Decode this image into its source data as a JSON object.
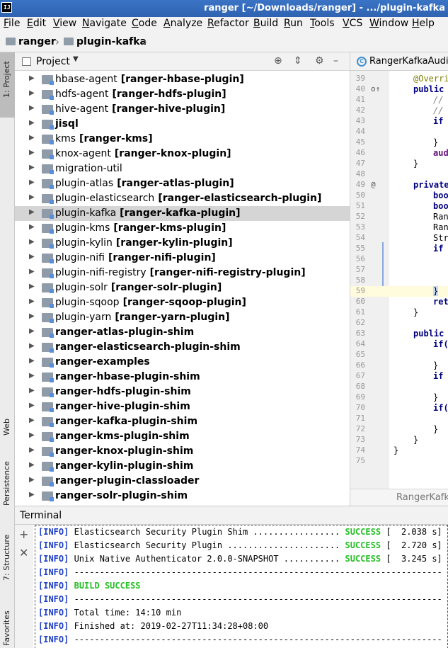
{
  "window": {
    "app_icon": "IJ",
    "title": "ranger [~/Downloads/ranger] - .../plugin-kafka"
  },
  "menu": [
    "File",
    "Edit",
    "View",
    "Navigate",
    "Code",
    "Analyze",
    "Refactor",
    "Build",
    "Run",
    "Tools",
    "VCS",
    "Window",
    "Help"
  ],
  "breadcrumb": [
    "ranger",
    "plugin-kafka"
  ],
  "left_tool_tabs": {
    "project": "1: Project",
    "web": "Web",
    "persistence": "Persistence",
    "structure": "7: Structure",
    "favorites": "Favorites"
  },
  "project_panel": {
    "title": "Project",
    "items": [
      {
        "name": "hbase-agent",
        "module": "[ranger-hbase-plugin]",
        "bold": false
      },
      {
        "name": "hdfs-agent",
        "module": "[ranger-hdfs-plugin]",
        "bold": false
      },
      {
        "name": "hive-agent",
        "module": "[ranger-hive-plugin]",
        "bold": false
      },
      {
        "name": "jisql",
        "module": "",
        "bold": true
      },
      {
        "name": "kms",
        "module": "[ranger-kms]",
        "bold": false
      },
      {
        "name": "knox-agent",
        "module": "[ranger-knox-plugin]",
        "bold": false
      },
      {
        "name": "migration-util",
        "module": "",
        "bold": false
      },
      {
        "name": "plugin-atlas",
        "module": "[ranger-atlas-plugin]",
        "bold": false
      },
      {
        "name": "plugin-elasticsearch",
        "module": "[ranger-elasticsearch-plugin]",
        "bold": false
      },
      {
        "name": "plugin-kafka",
        "module": "[ranger-kafka-plugin]",
        "bold": false,
        "selected": true
      },
      {
        "name": "plugin-kms",
        "module": "[ranger-kms-plugin]",
        "bold": false
      },
      {
        "name": "plugin-kylin",
        "module": "[ranger-kylin-plugin]",
        "bold": false
      },
      {
        "name": "plugin-nifi",
        "module": "[ranger-nifi-plugin]",
        "bold": false
      },
      {
        "name": "plugin-nifi-registry",
        "module": "[ranger-nifi-registry-plugin]",
        "bold": false
      },
      {
        "name": "plugin-solr",
        "module": "[ranger-solr-plugin]",
        "bold": false
      },
      {
        "name": "plugin-sqoop",
        "module": "[ranger-sqoop-plugin]",
        "bold": false
      },
      {
        "name": "plugin-yarn",
        "module": "[ranger-yarn-plugin]",
        "bold": false
      },
      {
        "name": "ranger-atlas-plugin-shim",
        "module": "",
        "bold": true
      },
      {
        "name": "ranger-elasticsearch-plugin-shim",
        "module": "",
        "bold": true
      },
      {
        "name": "ranger-examples",
        "module": "",
        "bold": true
      },
      {
        "name": "ranger-hbase-plugin-shim",
        "module": "",
        "bold": true
      },
      {
        "name": "ranger-hdfs-plugin-shim",
        "module": "",
        "bold": true
      },
      {
        "name": "ranger-hive-plugin-shim",
        "module": "",
        "bold": true
      },
      {
        "name": "ranger-kafka-plugin-shim",
        "module": "",
        "bold": true
      },
      {
        "name": "ranger-kms-plugin-shim",
        "module": "",
        "bold": true
      },
      {
        "name": "ranger-knox-plugin-shim",
        "module": "",
        "bold": true
      },
      {
        "name": "ranger-kylin-plugin-shim",
        "module": "",
        "bold": true
      },
      {
        "name": "ranger-plugin-classloader",
        "module": "",
        "bold": true
      },
      {
        "name": "ranger-solr-plugin-shim",
        "module": "",
        "bold": true
      }
    ]
  },
  "editor": {
    "tab": "RangerKafkaAudi",
    "footer": "RangerKafk",
    "lines": [
      {
        "n": "39",
        "code": "@Overri",
        "cls": "ann",
        "indent": 0
      },
      {
        "n": "40",
        "code": "public ",
        "cls": "kw",
        "indent": 0,
        "mark": "o↑"
      },
      {
        "n": "41",
        "code": "//",
        "cls": "cmt",
        "indent": 2
      },
      {
        "n": "42",
        "code": "//",
        "cls": "cmt",
        "indent": 2
      },
      {
        "n": "43",
        "code": "if",
        "cls": "kw",
        "indent": 2
      },
      {
        "n": "44",
        "code": "",
        "cls": "",
        "indent": 0
      },
      {
        "n": "45",
        "code": "}",
        "cls": "",
        "indent": 2
      },
      {
        "n": "46",
        "code": "aud",
        "cls": "fld",
        "indent": 2
      },
      {
        "n": "47",
        "code": "}",
        "cls": "",
        "indent": 0
      },
      {
        "n": "48",
        "code": "",
        "cls": "",
        "indent": 0
      },
      {
        "n": "49",
        "code": "private",
        "cls": "kw",
        "indent": 0,
        "mark": "@"
      },
      {
        "n": "50",
        "code": "boo",
        "cls": "kw",
        "indent": 2
      },
      {
        "n": "51",
        "code": "boo",
        "cls": "kw",
        "indent": 2
      },
      {
        "n": "52",
        "code": "Ran",
        "cls": "",
        "indent": 2
      },
      {
        "n": "53",
        "code": "Ran",
        "cls": "",
        "indent": 2
      },
      {
        "n": "54",
        "code": "Str",
        "cls": "",
        "indent": 2
      },
      {
        "n": "55",
        "code": "if",
        "cls": "kw",
        "indent": 2
      },
      {
        "n": "56",
        "code": "",
        "cls": "",
        "indent": 0
      },
      {
        "n": "57",
        "code": "",
        "cls": "",
        "indent": 0
      },
      {
        "n": "58",
        "code": "",
        "cls": "",
        "indent": 0
      },
      {
        "n": "59",
        "code": "}",
        "cls": "",
        "indent": 2,
        "caret": true
      },
      {
        "n": "60",
        "code": "ret",
        "cls": "kw",
        "indent": 2
      },
      {
        "n": "61",
        "code": "}",
        "cls": "",
        "indent": 0
      },
      {
        "n": "62",
        "code": "",
        "cls": "",
        "indent": 0
      },
      {
        "n": "63",
        "code": "public ",
        "cls": "kw",
        "indent": 0
      },
      {
        "n": "64",
        "code": "if(",
        "cls": "kw",
        "indent": 2
      },
      {
        "n": "65",
        "code": "",
        "cls": "",
        "indent": 0
      },
      {
        "n": "66",
        "code": "}",
        "cls": "",
        "indent": 2
      },
      {
        "n": "67",
        "code": "if",
        "cls": "kw",
        "indent": 2
      },
      {
        "n": "68",
        "code": "",
        "cls": "",
        "indent": 0
      },
      {
        "n": "69",
        "code": "}",
        "cls": "",
        "indent": 2
      },
      {
        "n": "70",
        "code": "if(",
        "cls": "kw",
        "indent": 2
      },
      {
        "n": "71",
        "code": "",
        "cls": "",
        "indent": 0
      },
      {
        "n": "72",
        "code": "}",
        "cls": "",
        "indent": 2
      },
      {
        "n": "73",
        "code": "}",
        "cls": "",
        "indent": 0
      },
      {
        "n": "74",
        "code": "}",
        "cls": "",
        "indent": -2
      },
      {
        "n": "75",
        "code": "",
        "cls": "",
        "indent": 0
      }
    ]
  },
  "terminal": {
    "title": "Terminal",
    "lines": [
      {
        "tag": "[INFO]",
        "text": " Elasticsearch Security Plugin Shim ................. ",
        "status": "SUCCESS",
        "time": " [  2.038 s]"
      },
      {
        "tag": "[INFO]",
        "text": " Elasticsearch Security Plugin ...................... ",
        "status": "SUCCESS",
        "time": " [  2.720 s]"
      },
      {
        "tag": "[INFO]",
        "text": " Unix Native Authenticator 2.0.0-SNAPSHOT ........... ",
        "status": "SUCCESS",
        "time": " [  3.245 s]"
      },
      {
        "tag": "[INFO]",
        "text": " ------------------------------------------------------------------------",
        "status": "",
        "time": ""
      },
      {
        "tag": "[INFO]",
        "text": " ",
        "status": "BUILD SUCCESS",
        "time": ""
      },
      {
        "tag": "[INFO]",
        "text": " ------------------------------------------------------------------------",
        "status": "",
        "time": ""
      },
      {
        "tag": "[INFO]",
        "text": " Total time: 14:10 min",
        "status": "",
        "time": ""
      },
      {
        "tag": "[INFO]",
        "text": " Finished at: 2019-02-27T11:34:28+08:00",
        "status": "",
        "time": ""
      },
      {
        "tag": "[INFO]",
        "text": " ------------------------------------------------------------------------",
        "status": "",
        "time": ""
      }
    ]
  }
}
